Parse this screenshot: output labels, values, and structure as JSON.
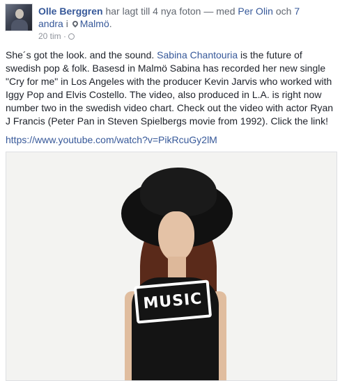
{
  "header": {
    "author": "Olle Berggren",
    "action": "har lagt till 4 nya foton",
    "with_prefix": "— med",
    "tagged_person": "Per Olin",
    "and_text": "och",
    "others": "7 andra",
    "in_text": "i",
    "location": "Malmö",
    "timestamp": "20 tim",
    "separator": "·"
  },
  "post": {
    "text_1": "She´s got the look. and the sound. ",
    "artist_link": "Sabina Chantouria",
    "text_2": " is the future of swedish pop & folk. Basesd in Malmö Sabina has recorded her new single \"Cry for me\" in Los Angeles with the producer Kevin Jarvis who worked with Iggy Pop and Elvis Costello. The video, also produced in L.A. is right now number two in the swedish video chart. Check out the video with actor Ryan J Francis (Peter Pan in Steven Spielbergs movie from 1992). Click the link!",
    "url": "https://www.youtube.com/watch?v=PikRcuGy2lM"
  },
  "photo": {
    "shirt_text": "MUSIC"
  }
}
